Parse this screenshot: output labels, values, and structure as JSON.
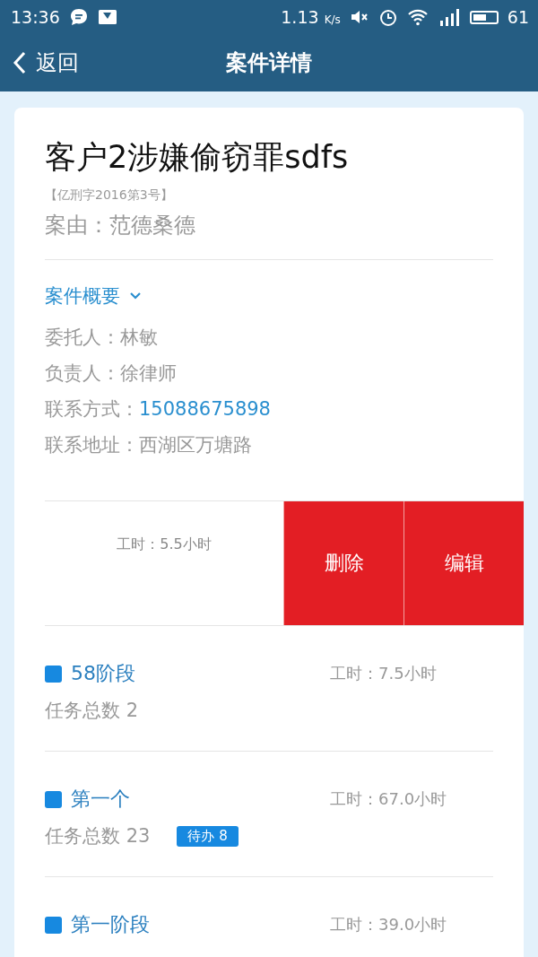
{
  "status_bar": {
    "time": "13:36",
    "speed": "1.13",
    "speed_unit": "K/s",
    "battery_text": "61"
  },
  "nav": {
    "back": "返回",
    "title": "案件详情"
  },
  "case": {
    "title": "客户2涉嫌偷窃罪sdfs",
    "number": "【亿刑字2016第3号】",
    "cause": "案由：范德桑德"
  },
  "summary": {
    "label": "案件概要",
    "expanded": true,
    "fields": [
      {
        "label": "委托人：",
        "value": "林敏",
        "kind": "text"
      },
      {
        "label": "负责人：",
        "value": "徐律师",
        "kind": "text"
      },
      {
        "label": "联系方式：",
        "value": "15088675898",
        "kind": "link"
      },
      {
        "label": "联系地址：",
        "value": "西湖区万塘路",
        "kind": "text"
      }
    ]
  },
  "swiped_row": {
    "hours": "工时：5.5小时",
    "actions": [
      "删除",
      "编辑"
    ]
  },
  "stages": [
    {
      "name": "58阶段",
      "hours": "工时：7.5小时",
      "task_count": "任务总数 2"
    },
    {
      "name": "第一个",
      "hours": "工时：67.0小时",
      "task_count": "任务总数 23",
      "badge": "待办 8"
    },
    {
      "name": "第一阶段",
      "hours": "工时：39.0小时"
    }
  ]
}
